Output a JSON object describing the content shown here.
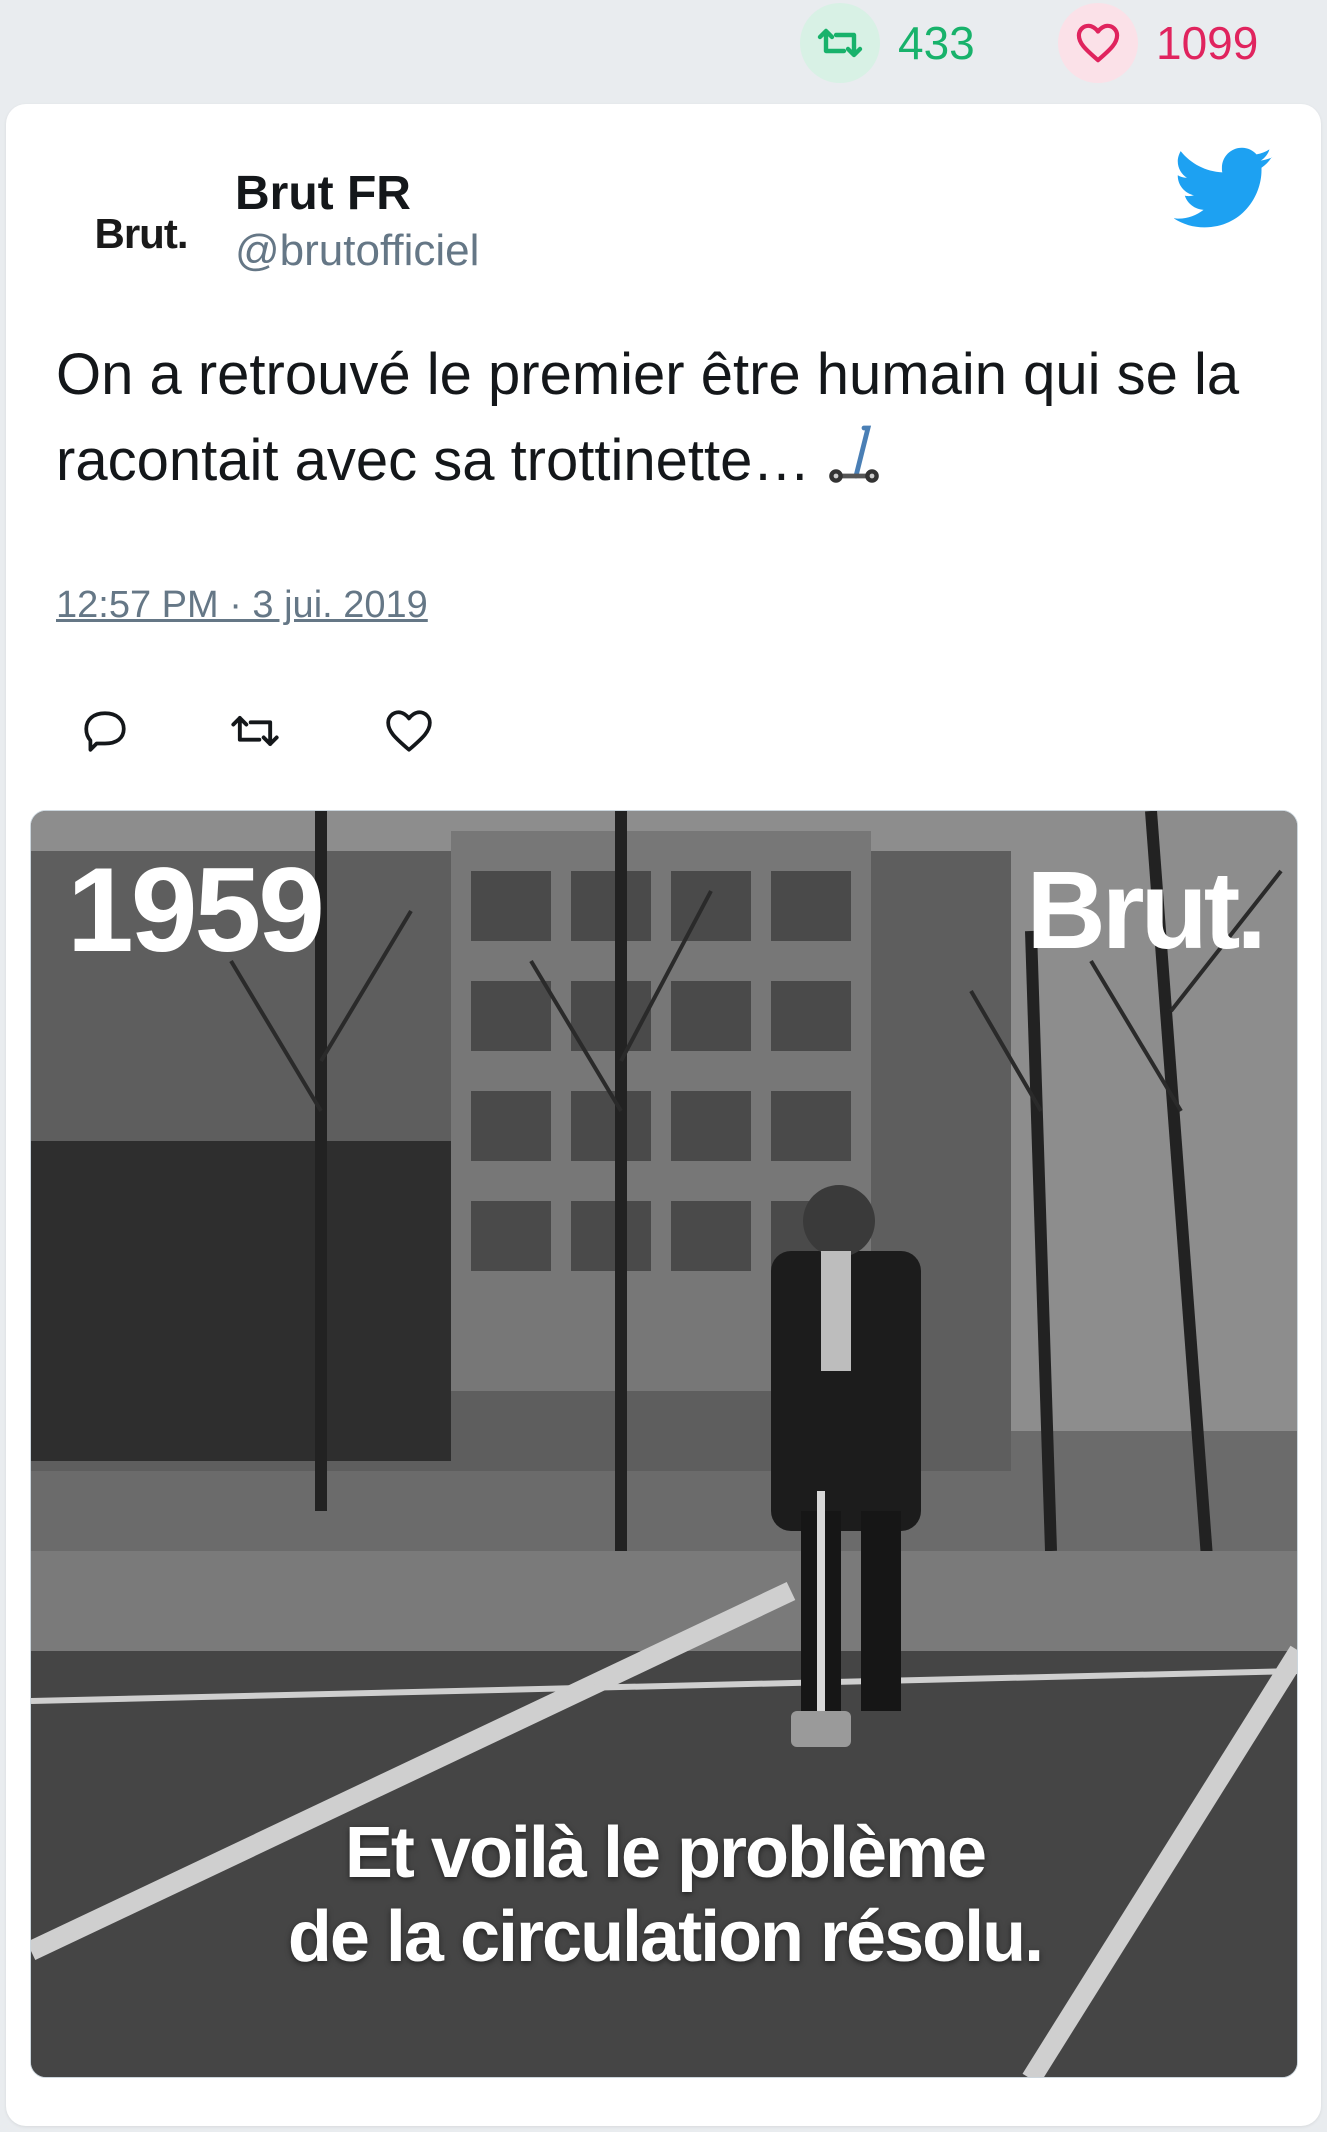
{
  "stats": {
    "retweets": "433",
    "likes": "1099",
    "retweet_color": "#18b26b",
    "like_color": "#e0245e"
  },
  "tweet": {
    "avatar_text": "Brut.",
    "display_name": "Brut FR",
    "handle": "@brutofficiel",
    "text": "On a retrouvé le premier être humain qui se la racontait avec sa trottinette…",
    "emoji_icon": "kick-scooter-icon",
    "timestamp": "12:57 PM · 3 jui. 2019",
    "brand_color": "#1da1f2"
  },
  "actions": {
    "reply_icon": "reply-icon",
    "retweet_icon": "retweet-icon",
    "like_icon": "heart-icon"
  },
  "media": {
    "year": "1959",
    "brand": "Brut.",
    "caption_line1": "Et voilà le problème",
    "caption_line2": "de la circulation résolu."
  }
}
